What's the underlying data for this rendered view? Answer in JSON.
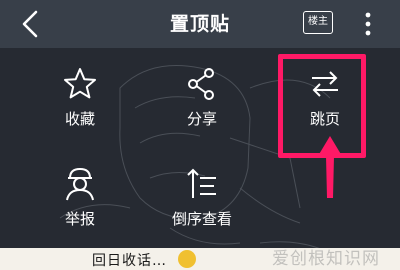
{
  "topbar": {
    "title": "置顶贴",
    "owner_button_label": "楼主"
  },
  "menu": {
    "items": [
      {
        "label": "收藏",
        "icon": "star-icon"
      },
      {
        "label": "分享",
        "icon": "share-icon"
      },
      {
        "label": "跳页",
        "icon": "swap-arrows-icon"
      },
      {
        "label": "举报",
        "icon": "report-user-icon"
      },
      {
        "label": "倒序查看",
        "icon": "reverse-order-icon"
      }
    ],
    "highlighted_item": "跳页",
    "highlight_color": "#ff1966"
  },
  "content": {
    "partial_text": "回日收话…"
  },
  "watermark": {
    "text": "爱创根知识网"
  }
}
